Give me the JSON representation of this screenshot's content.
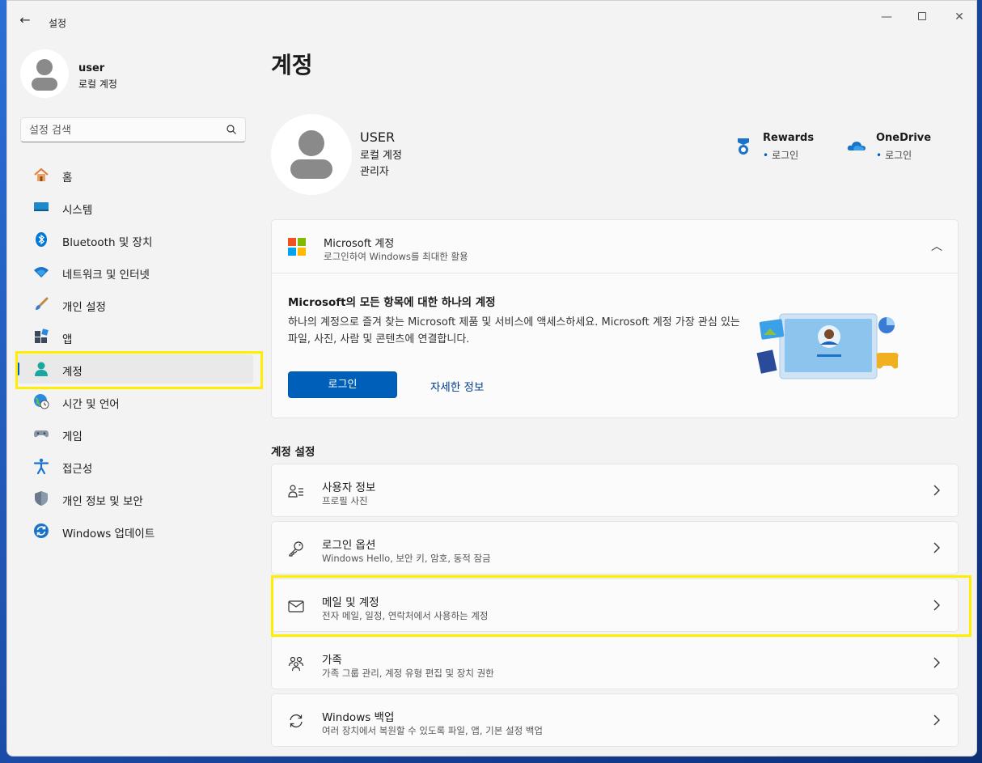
{
  "window": {
    "title": "설정",
    "back_glyph": "←",
    "min_glyph": "—",
    "close_glyph": "✕"
  },
  "user": {
    "name": "user",
    "type": "로컬 계정"
  },
  "search": {
    "placeholder": "설정 검색"
  },
  "sidebar": {
    "items": [
      {
        "label": "홈",
        "icon": "home-icon"
      },
      {
        "label": "시스템",
        "icon": "system-icon"
      },
      {
        "label": "Bluetooth 및 장치",
        "icon": "bluetooth-icon"
      },
      {
        "label": "네트워크 및 인터넷",
        "icon": "wifi-icon"
      },
      {
        "label": "개인 설정",
        "icon": "brush-icon"
      },
      {
        "label": "앱",
        "icon": "apps-icon"
      },
      {
        "label": "계정",
        "icon": "account-icon",
        "active": true
      },
      {
        "label": "시간 및 언어",
        "icon": "globe-clock-icon"
      },
      {
        "label": "게임",
        "icon": "gamepad-icon"
      },
      {
        "label": "접근성",
        "icon": "accessibility-icon"
      },
      {
        "label": "개인 정보 및 보안",
        "icon": "shield-icon"
      },
      {
        "label": "Windows 업데이트",
        "icon": "update-icon"
      }
    ]
  },
  "main": {
    "title": "계정",
    "profile": {
      "name": "USER",
      "type": "로컬 계정",
      "role": "관리자"
    },
    "services": [
      {
        "name": "Rewards",
        "status": "로그인",
        "icon": "rewards-icon"
      },
      {
        "name": "OneDrive",
        "status": "로그인",
        "icon": "onedrive-icon"
      }
    ],
    "microsoft_card": {
      "title": "Microsoft 계정",
      "subtitle": "로그인하여 Windows를 최대한 활용",
      "heading": "Microsoft의 모든 항목에 대한 하나의 계정",
      "description": "하나의 계정으로 즐겨 찾는 Microsoft 제품 및 서비스에 액세스하세요. Microsoft 계정 가장 관심 있는 파일, 사진, 사람 및 콘텐츠에 연결합니다.",
      "login_label": "로그인",
      "more_label": "자세한 정보",
      "toggle_glyph": "︿"
    },
    "section_title": "계정 설정",
    "settings": [
      {
        "title": "사용자 정보",
        "subtitle": "프로필 사진",
        "icon": "user-info-icon"
      },
      {
        "title": "로그인 옵션",
        "subtitle": "Windows Hello, 보안 키, 암호, 동적 잠금",
        "icon": "key-icon"
      },
      {
        "title": "메일 및 계정",
        "subtitle": "전자 메일, 일정, 연락처에서 사용하는 계정",
        "icon": "mail-icon"
      },
      {
        "title": "가족",
        "subtitle": "가족 그룹 관리, 계정 유형 편집 및 장치 권한",
        "icon": "family-icon"
      },
      {
        "title": "Windows 백업",
        "subtitle": "여러 장치에서 복원할 수 있도록 파일, 앱, 기본 설정 백업",
        "icon": "backup-icon"
      }
    ]
  },
  "colors": {
    "accent": "#005fb8",
    "highlight": "#ffee00",
    "background": "#f3f3f3",
    "card": "#fbfbfb"
  }
}
